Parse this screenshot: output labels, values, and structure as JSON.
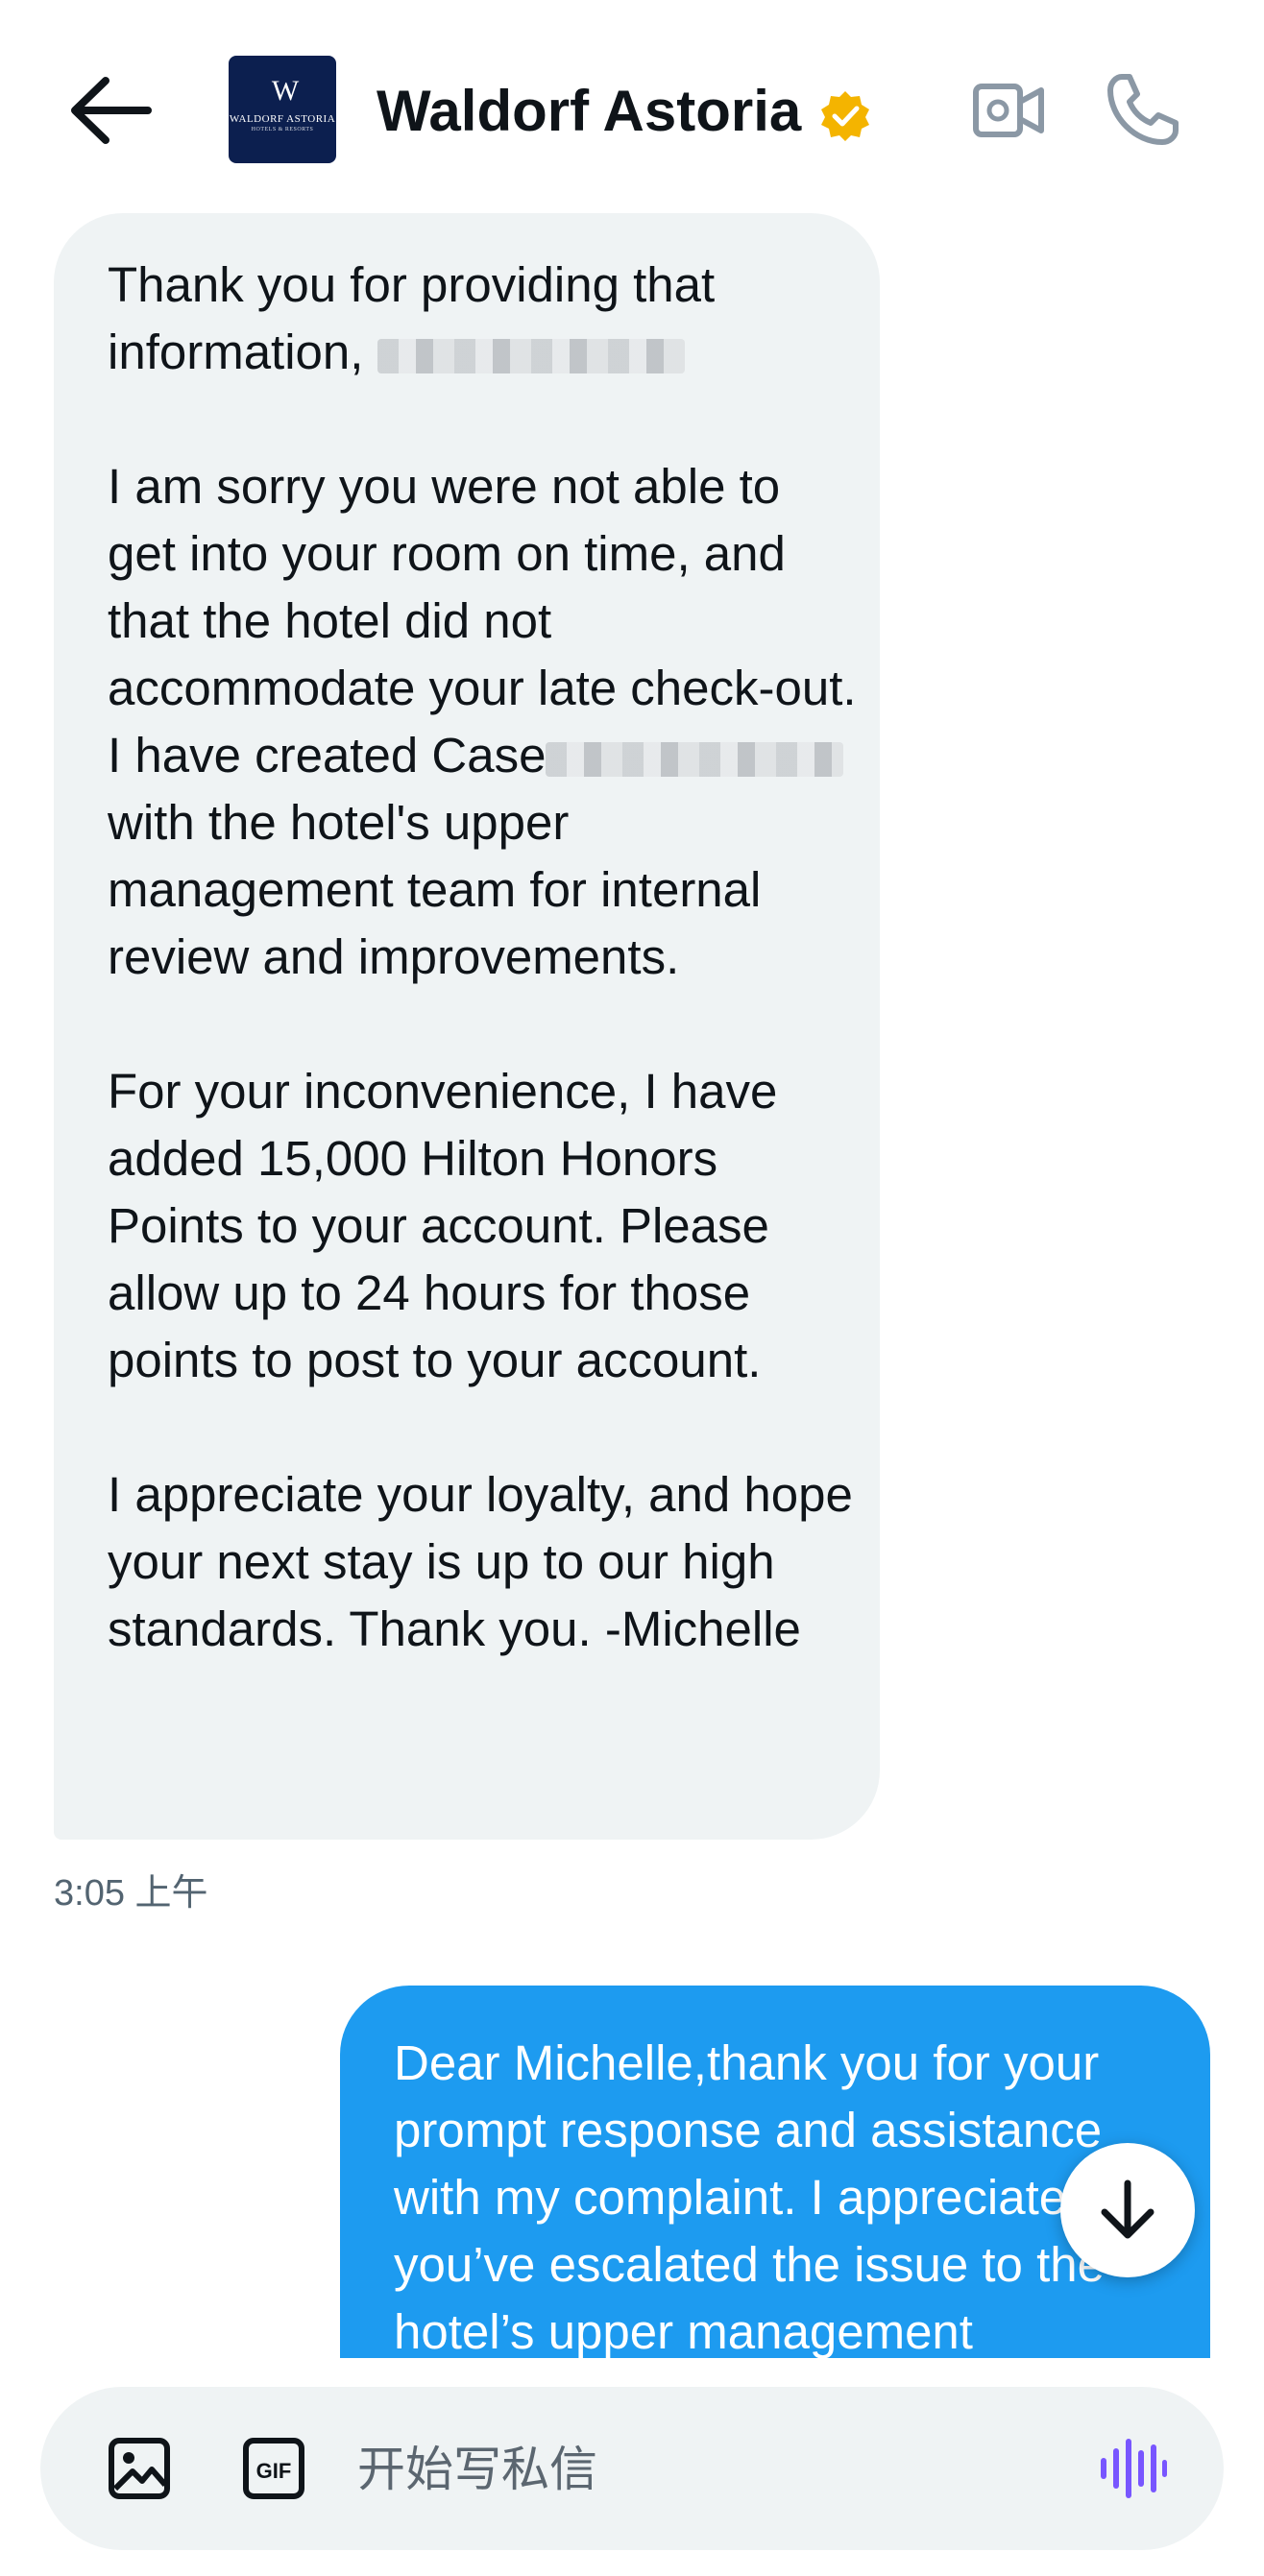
{
  "header": {
    "title": "Waldorf Astoria",
    "logo": {
      "monogram": "W",
      "wordmark": "WALDORF ASTORIA",
      "sub": "HOTELS & RESORTS"
    },
    "icons": [
      "back-arrow-icon",
      "verified-badge-icon",
      "video-call-icon",
      "phone-icon"
    ],
    "verified_color": "#f4b400"
  },
  "messages": [
    {
      "direction": "incoming",
      "p1_before": "Thank you for providing that information, ",
      "p2_before": "I am sorry you were not able to get into your room on time, and that the hotel did not accommodate your late check-out.  I have created Case",
      "p2_after": " with the hotel's upper management team for internal review and improvements.",
      "p3": "For your inconvenience, I have added 15,000 Hilton Honors Points to your account. Please allow up to 24 hours for those points to post to your account.",
      "p4": "I appreciate your loyalty, and hope your next stay is up to our high standards. Thank you. -Michelle",
      "time": "3:05 上午"
    },
    {
      "direction": "outgoing",
      "text": "Dear Michelle,thank you for your prompt response and assistance with my complaint. I appreciate that you’ve escalated the issue to the hotel’s upper management"
    }
  ],
  "composer": {
    "placeholder": "开始写私信"
  },
  "colors": {
    "incoming_bubble": "#eff3f4",
    "outgoing_bubble": "#1d9bf0",
    "voice_accent": "#7856ff"
  }
}
